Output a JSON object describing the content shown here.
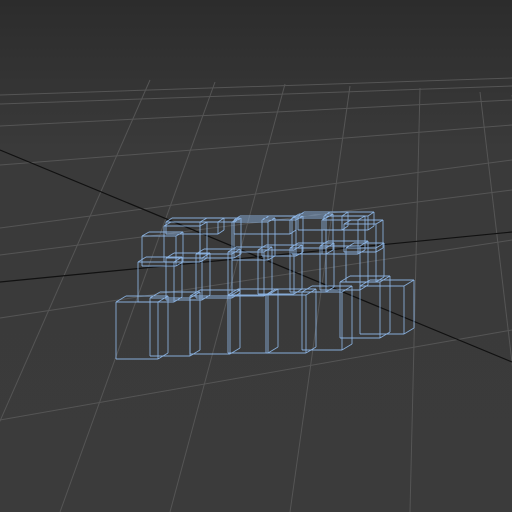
{
  "viewport": {
    "name": "perspective-viewport",
    "background_color": "#3a3a3a",
    "grid_color": "#555555",
    "grid_axis_color": "#111111",
    "wireframe_color": "#8fb8e8",
    "object_type": "wireframe-box-cluster"
  }
}
